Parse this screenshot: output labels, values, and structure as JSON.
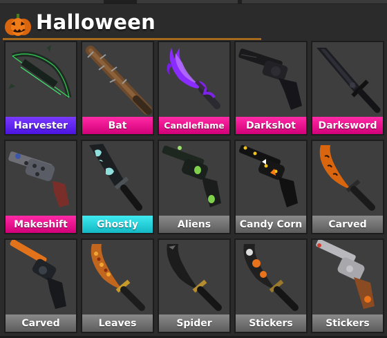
{
  "header": {
    "title": "Halloween",
    "icon": "pumpkin-icon"
  },
  "colors": {
    "accent_underline": "#a56a1e",
    "label_purple": "#5b22f0",
    "label_pink": "#e80a8c",
    "label_teal": "#22d4dd",
    "label_gray": "#707070"
  },
  "items": [
    {
      "name": "Harvester",
      "rarity_color": "purple",
      "icon": "crossbow-icon"
    },
    {
      "name": "Bat",
      "rarity_color": "pink",
      "icon": "spiked-bat-icon"
    },
    {
      "name": "Candleflame",
      "rarity_color": "pink",
      "icon": "flame-knife-icon"
    },
    {
      "name": "Darkshot",
      "rarity_color": "pink",
      "icon": "dark-revolver-icon"
    },
    {
      "name": "Darksword",
      "rarity_color": "pink",
      "icon": "dark-sword-icon"
    },
    {
      "name": "Makeshift",
      "rarity_color": "pink",
      "icon": "makeshift-gun-icon"
    },
    {
      "name": "Ghostly",
      "rarity_color": "teal",
      "icon": "ghost-knife-icon"
    },
    {
      "name": "Aliens",
      "rarity_color": "gray",
      "icon": "alien-gun-icon"
    },
    {
      "name": "Candy Corn",
      "rarity_color": "gray",
      "icon": "candy-corn-gun-icon"
    },
    {
      "name": "Carved",
      "rarity_color": "gray",
      "icon": "carved-knife-icon"
    },
    {
      "name": "Carved",
      "rarity_color": "gray",
      "icon": "carved-gun-icon"
    },
    {
      "name": "Leaves",
      "rarity_color": "gray",
      "icon": "leaves-knife-icon"
    },
    {
      "name": "Spider",
      "rarity_color": "gray",
      "icon": "spider-knife-icon"
    },
    {
      "name": "Stickers",
      "rarity_color": "gray",
      "icon": "stickers-knife-icon"
    },
    {
      "name": "Stickers",
      "rarity_color": "gray",
      "icon": "stickers-gun-icon"
    }
  ]
}
